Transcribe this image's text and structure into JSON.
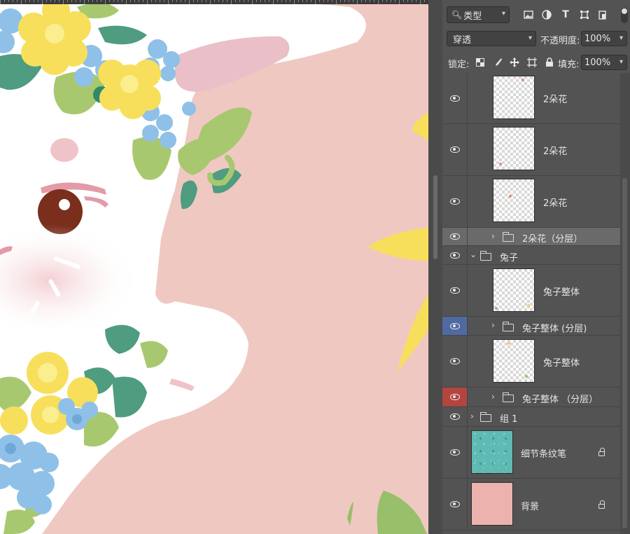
{
  "filter": {
    "label": "类型",
    "icons": [
      "image-filter-icon",
      "adjustment-filter-icon",
      "text-filter-icon",
      "shape-filter-icon",
      "smart-object-filter-icon"
    ]
  },
  "blend": {
    "mode": "穿透",
    "opacity_label": "不透明度:",
    "opacity_value": "100%"
  },
  "lock": {
    "label": "锁定:",
    "fill_label": "填充:",
    "fill_value": "100%"
  },
  "layers": [
    {
      "name": "2朵花",
      "type": "layer",
      "visible": true
    },
    {
      "name": "2朵花",
      "type": "layer",
      "visible": true
    },
    {
      "name": "2朵花",
      "type": "layer",
      "visible": true
    },
    {
      "name": "2朵花（分层）",
      "type": "group",
      "expanded": false,
      "selected": true,
      "visible": true
    },
    {
      "name": "兔子",
      "type": "group",
      "expanded": true,
      "visible": true
    },
    {
      "name": "兔子整体",
      "type": "layer",
      "visible": true
    },
    {
      "name": "兔子整体 (分层)",
      "type": "group",
      "expanded": false,
      "color_tag": "blue",
      "visible": true
    },
    {
      "name": "兔子整体",
      "type": "layer",
      "visible": true
    },
    {
      "name": "兔子整体 （分层）",
      "type": "group",
      "expanded": false,
      "color_tag": "red",
      "visible": true
    },
    {
      "name": "组 1",
      "type": "group",
      "expanded": false,
      "visible": true
    },
    {
      "name": "细节条纹笔",
      "type": "layer",
      "locked": true,
      "visible": true
    },
    {
      "name": "背景",
      "type": "layer",
      "locked": true,
      "visible": true
    }
  ],
  "colors": {
    "panel_bg": "#535353",
    "canvas_bg": "#f0c8c2",
    "selected_row": "#6a6a6a",
    "blue_tag": "#4f6aa3",
    "red_tag": "#b3453f",
    "background_swatch": "#ecb2ae",
    "texture_swatch": "#5fbab3"
  }
}
